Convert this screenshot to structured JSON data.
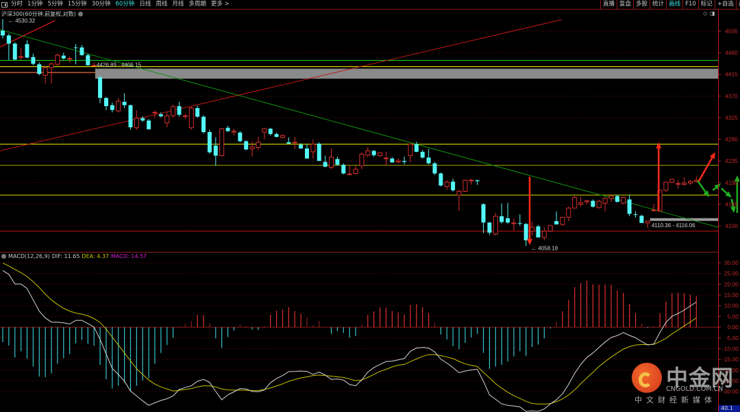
{
  "toolbar": {
    "periods": [
      "分时",
      "1分钟",
      "5分钟",
      "15分钟",
      "30分钟",
      "60分钟",
      "日线",
      "周线",
      "月线",
      "多周期",
      "更多 >"
    ],
    "active_period": "60分钟",
    "right_buttons": [
      "直播",
      "复盘",
      "多股",
      "统计",
      "画线",
      "F10",
      "标记",
      "+自选",
      "返回"
    ],
    "active_right": "画线"
  },
  "title": "沪深300(60分钟,前复权,对数)",
  "window_icons": [
    "◇",
    "◨"
  ],
  "macd_header": {
    "name": "MACD(12,26,9)",
    "dif_label": "DIF: 11.65",
    "dea_label": "DEA: 4.37",
    "macd_label": "MACD: 14.57"
  },
  "colors": {
    "bull": "#d83030",
    "bear": "#54f6f6",
    "dif": "#d8d8d8",
    "dea": "#c8c400",
    "macd_label": "#d020d0",
    "axis": "#c02828",
    "grid": "#6a1010"
  },
  "logo": {
    "cn": "中金网",
    "en": "CNGOLD.COM.CN",
    "sub": "中文财经新媒体"
  },
  "corner_value": "40.1",
  "chart_data": [
    {
      "type": "candlestick",
      "title": "沪深300(60分钟,前复权,对数)",
      "ylim": [
        4046,
        4527
      ],
      "yticks": [
        4505,
        4460,
        4415,
        4370,
        4325,
        4280,
        4235,
        4190,
        4145,
        4100
      ],
      "grid": true,
      "ohlc": [
        [
          4506,
          4530,
          4490,
          4496
        ],
        [
          4496,
          4500,
          4445,
          4479
        ],
        [
          4479,
          4482,
          4444,
          4446
        ],
        [
          4450,
          4470,
          4445,
          4452
        ],
        [
          4478,
          4486,
          4448,
          4450
        ],
        [
          4451,
          4458,
          4434,
          4437
        ],
        [
          4436,
          4440,
          4413,
          4416
        ],
        [
          4413,
          4432,
          4396,
          4429
        ],
        [
          4429,
          4440,
          4396,
          4437
        ],
        [
          4436,
          4458,
          4433,
          4455
        ],
        [
          4454,
          4460,
          4446,
          4448
        ],
        [
          4448,
          4452,
          4440,
          4448
        ],
        [
          4471,
          4478,
          4436,
          4470
        ],
        [
          4471,
          4476,
          4454,
          4455
        ],
        [
          4455,
          4458,
          4433,
          4434
        ],
        [
          4434,
          4440,
          4432,
          4434
        ],
        [
          4409,
          4412,
          4355,
          4366
        ],
        [
          4366,
          4368,
          4341,
          4349
        ],
        [
          4351,
          4356,
          4336,
          4341
        ],
        [
          4339,
          4366,
          4336,
          4359
        ],
        [
          4358,
          4376,
          4345,
          4351
        ],
        [
          4351,
          4352,
          4300,
          4305
        ],
        [
          4304,
          4340,
          4300,
          4324
        ],
        [
          4324,
          4328,
          4316,
          4319
        ],
        [
          4319,
          4322,
          4300,
          4301
        ],
        [
          4336,
          4340,
          4325,
          4336
        ],
        [
          4332,
          4336,
          4325,
          4328
        ],
        [
          4314,
          4336,
          4305,
          4329
        ],
        [
          4329,
          4352,
          4325,
          4348
        ],
        [
          4349,
          4358,
          4327,
          4331
        ],
        [
          4329,
          4333,
          4322,
          4329
        ],
        [
          4304,
          4348,
          4300,
          4345
        ],
        [
          4345,
          4350,
          4325,
          4327
        ],
        [
          4327,
          4330,
          4292,
          4295
        ],
        [
          4295,
          4300,
          4250,
          4253
        ],
        [
          4267,
          4284,
          4225,
          4246
        ],
        [
          4246,
          4304,
          4244,
          4302
        ],
        [
          4304,
          4308,
          4295,
          4297
        ],
        [
          4295,
          4302,
          4288,
          4297
        ],
        [
          4294,
          4297,
          4274,
          4276
        ],
        [
          4276,
          4278,
          4257,
          4259
        ],
        [
          4260,
          4276,
          4244,
          4264
        ],
        [
          4263,
          4285,
          4258,
          4274
        ],
        [
          4295,
          4304,
          4280,
          4302
        ],
        [
          4302,
          4304,
          4288,
          4291
        ],
        [
          4291,
          4294,
          4284,
          4285
        ],
        [
          4284,
          4290,
          4282,
          4288
        ],
        [
          4274,
          4284,
          4270,
          4271
        ],
        [
          4274,
          4285,
          4260,
          4274
        ],
        [
          4269,
          4272,
          4260,
          4261
        ],
        [
          4261,
          4270,
          4240,
          4240
        ],
        [
          4254,
          4279,
          4240,
          4270
        ],
        [
          4271,
          4274,
          4235,
          4235
        ],
        [
          4233,
          4246,
          4222,
          4223
        ],
        [
          4222,
          4261,
          4218,
          4243
        ],
        [
          4239,
          4244,
          4225,
          4227
        ],
        [
          4227,
          4230,
          4207,
          4209
        ],
        [
          4208,
          4225,
          4205,
          4208
        ],
        [
          4209,
          4225,
          4207,
          4218
        ],
        [
          4225,
          4253,
          4218,
          4249
        ],
        [
          4247,
          4264,
          4243,
          4256
        ],
        [
          4256,
          4258,
          4244,
          4247
        ],
        [
          4246,
          4253,
          4243,
          4252
        ],
        [
          4240,
          4254,
          4225,
          4241
        ],
        [
          4240,
          4243,
          4231,
          4232
        ],
        [
          4233,
          4241,
          4230,
          4235
        ],
        [
          4235,
          4244,
          4228,
          4233
        ],
        [
          4246,
          4272,
          4232,
          4270
        ],
        [
          4270,
          4275,
          4253,
          4254
        ],
        [
          4254,
          4258,
          4240,
          4242
        ],
        [
          4242,
          4260,
          4228,
          4230
        ],
        [
          4230,
          4233,
          4206,
          4209
        ],
        [
          4209,
          4211,
          4182,
          4184
        ],
        [
          4182,
          4195,
          4176,
          4191
        ],
        [
          4192,
          4198,
          4171,
          4174
        ],
        [
          4164,
          4175,
          4131,
          4172
        ],
        [
          4172,
          4196,
          4170,
          4195
        ],
        [
          4195,
          4198,
          4186,
          4195
        ],
        [
          4195,
          4196,
          4185,
          4193
        ],
        [
          4145,
          4147,
          4085,
          4107
        ],
        [
          4107,
          4108,
          4081,
          4086
        ],
        [
          4083,
          4127,
          4080,
          4120
        ],
        [
          4120,
          4147,
          4105,
          4108
        ],
        [
          4116,
          4148,
          4104,
          4107
        ],
        [
          4106,
          4115,
          4090,
          4106
        ],
        [
          4106,
          4124,
          4100,
          4105
        ],
        [
          4104,
          4106,
          4058,
          4070
        ],
        [
          4089,
          4109,
          4080,
          4097
        ],
        [
          4099,
          4102,
          4076,
          4076
        ],
        [
          4076,
          4097,
          4070,
          4089
        ],
        [
          4089,
          4101,
          4087,
          4101
        ],
        [
          4110,
          4130,
          4103,
          4103
        ],
        [
          4103,
          4118,
          4100,
          4118
        ],
        [
          4118,
          4140,
          4110,
          4137
        ],
        [
          4137,
          4162,
          4136,
          4159
        ],
        [
          4145,
          4160,
          4140,
          4148
        ],
        [
          4150,
          4154,
          4145,
          4152
        ],
        [
          4152,
          4155,
          4138,
          4140
        ],
        [
          4138,
          4154,
          4136,
          4151
        ],
        [
          4147,
          4160,
          4130,
          4157
        ],
        [
          4157,
          4164,
          4150,
          4162
        ],
        [
          4162,
          4165,
          4148,
          4150
        ],
        [
          4147,
          4160,
          4145,
          4159
        ],
        [
          4155,
          4165,
          4120,
          4125
        ],
        [
          4124,
          4130,
          4117,
          4123
        ],
        [
          4121,
          4123,
          4106,
          4106
        ],
        [
          4106,
          4110,
          4096,
          4110
        ],
        [
          4133,
          4145,
          4130,
          4133
        ],
        [
          4131,
          4174,
          4131,
          4174
        ],
        [
          4174,
          4192,
          4170,
          4191
        ],
        [
          4191,
          4198,
          4189,
          4197
        ],
        [
          4188,
          4195,
          4178,
          4188
        ],
        [
          4186,
          4201,
          4184,
          4189
        ],
        [
          4189,
          4196,
          4185,
          4192
        ],
        [
          4192,
          4203,
          4190,
          4195
        ]
      ],
      "annotations": {
        "high_label": "4530.32",
        "low_label": "4058.18",
        "zone_upper_label": "4426.89 - 4406.15",
        "zone_upper": [
          4406.15,
          4426.89
        ],
        "zone_lower_label": "4110.36 - 4116.06",
        "zone_lower": [
          4110.36,
          4116.06
        ],
        "hlines": [
          {
            "price": 4444,
            "color": "#20d020"
          },
          {
            "price": 4431,
            "color": "#e8e800"
          },
          {
            "price": 4419,
            "color": "#e07040"
          },
          {
            "price": 4270,
            "color": "#c8c400"
          },
          {
            "price": 4226,
            "color": "#8a8a00"
          },
          {
            "price": 4164,
            "color": "#c8c400"
          },
          {
            "price": 4089,
            "color": "#a01010"
          }
        ],
        "trendlines": [
          {
            "from": [
              -0.45,
              4256
            ],
            "to": [
              91.9,
              4529
            ],
            "color": "#c01818"
          },
          {
            "from": [
              -0.45,
              4508
            ],
            "to": [
              117.6,
              4097
            ],
            "color": "#109010"
          },
          {
            "from": [
              -0.45,
              4472
            ],
            "to": [
              8.6,
              4527
            ],
            "color": "#ff2020"
          }
        ],
        "arrows": [
          {
            "from": [
              86.6,
              4202
            ],
            "to": [
              86.6,
              4060
            ],
            "color": "#ff2a1a"
          },
          {
            "from": [
              107.8,
              4131
            ],
            "to": [
              107.8,
              4274
            ],
            "color": "#ff2a1a"
          },
          {
            "from": [
              114.4,
              4193
            ],
            "to": [
              117.1,
              4253
            ],
            "color": "#ff2a1a"
          },
          {
            "from": [
              114.2,
              4194
            ],
            "to": [
              116.1,
              4160
            ],
            "color": "#20b020"
          },
          {
            "from": [
              116.7,
              4174
            ],
            "to": [
              118.0,
              4188
            ],
            "color": "#20b020"
          },
          {
            "from": [
              118.1,
              4178
            ],
            "to": [
              119.8,
              4159
            ],
            "color": "#20b020"
          },
          {
            "from": [
              119.8,
              4156
            ],
            "to": [
              120.2,
              4127
            ],
            "color": "#20b020"
          },
          {
            "from": [
              120.7,
              4127
            ],
            "to": [
              120.7,
              4205
            ],
            "color": "#20b020"
          }
        ]
      }
    },
    {
      "type": "bar+line",
      "title": "MACD(12,26,9)",
      "ylim": [
        -39.5,
        33.5
      ],
      "yticks": [
        "30.00",
        "25.00",
        "20.00",
        "15.00",
        "10.00",
        "5.00",
        "0.00",
        "-5.00",
        "-10.00",
        "-15.00",
        "-20.00",
        "-25.00",
        "-30.00"
      ],
      "macd": [
        -6.9,
        -8.6,
        -14.1,
        -11.2,
        -14.6,
        -18.3,
        -23,
        -23.3,
        -21.5,
        -17,
        -14.4,
        -12.5,
        -7.5,
        -5.9,
        -7.8,
        -8.6,
        -17.6,
        -24.3,
        -28.6,
        -27.3,
        -25.7,
        -29.9,
        -27.3,
        -24.8,
        -23.8,
        -17,
        -12,
        -8.3,
        -4.9,
        0.4,
        1.7,
        2.9,
        5.9,
        5.7,
        1.9,
        -5.2,
        -9.7,
        -4.6,
        -1.5,
        1.2,
        0.6,
        -1.1,
        -1.3,
        0.6,
        5.9,
        7.7,
        8.2,
        9.3,
        7.5,
        6.2,
        4.5,
        0.9,
        2.9,
        0,
        -3.1,
        -1.8,
        -2.7,
        -4.9,
        -4.1,
        1.1,
        5.7,
        7.4,
        9.3,
        9.1,
        7.6,
        6.9,
        5.9,
        10.3,
        10.8,
        9.3,
        6.6,
        2.1,
        -3.4,
        -5.7,
        -8.8,
        -10.2,
        -7.3,
        -4.8,
        -3.1,
        -12,
        -19.4,
        -18.3,
        -17.5,
        -16,
        -13.6,
        -11.2,
        -13.3,
        -9.2,
        -8.1,
        -5.2,
        -0.6,
        2.5,
        7.4,
        12.8,
        18.7,
        20.6,
        21.7,
        19.9,
        19.8,
        19.8,
        19.8,
        17.2,
        16.1,
        10.8,
        6.6,
        1.7,
        -0.4,
        0.6,
        6.6,
        12,
        15.9,
        16.1,
        15.9,
        15.2,
        14.57
      ],
      "dif": [
        26.4,
        24.6,
        20.1,
        20.1,
        18,
        12.7,
        7.5,
        4.3,
        2.4,
        2.3,
        2,
        1.5,
        3.2,
        3.2,
        1.7,
        0.1,
        -5.7,
        -12.5,
        -19.2,
        -22,
        -25.2,
        -29.7,
        -32,
        -34.3,
        -36.4,
        -35.2,
        -34.1,
        -33.3,
        -32,
        -29,
        -28.1,
        -27.3,
        -25.2,
        -24.3,
        -25.7,
        -29.9,
        -33.8,
        -31.5,
        -30.1,
        -28.6,
        -28.8,
        -29.9,
        -30.1,
        -29.2,
        -25.9,
        -23.9,
        -22.5,
        -20.7,
        -20.6,
        -20.4,
        -20.6,
        -22,
        -20.9,
        -22.3,
        -24.3,
        -24.1,
        -24.6,
        -26.7,
        -27.3,
        -24.6,
        -20.9,
        -18.8,
        -17.3,
        -16,
        -15.8,
        -15.2,
        -14.6,
        -11.2,
        -9.7,
        -9.4,
        -9.7,
        -11.5,
        -14.9,
        -16.7,
        -18.8,
        -21.2,
        -20.4,
        -19.9,
        -19.6,
        -25.2,
        -31.5,
        -33.6,
        -35.7,
        -36.4,
        -36.7,
        -37.1,
        -39.2,
        -39,
        -39.2,
        -38.1,
        -35.7,
        -33.8,
        -31,
        -26.7,
        -21.5,
        -17.3,
        -14.1,
        -12,
        -9.4,
        -6.9,
        -4.8,
        -3.9,
        -2.5,
        -3.8,
        -4.9,
        -6.7,
        -8.3,
        -7.8,
        -2.5,
        2.2,
        5.1,
        6.4,
        8,
        9.9,
        11.65
      ],
      "dea": [
        29.9,
        28.5,
        26.9,
        25.4,
        23.6,
        21.2,
        18.5,
        15.4,
        12.7,
        10.6,
        8.8,
        7.5,
        6.6,
        6.1,
        5.3,
        4,
        2.2,
        -0.9,
        -4.6,
        -8.3,
        -12,
        -15.7,
        -19.4,
        -22,
        -24.6,
        -26.5,
        -27.8,
        -28.8,
        -29.7,
        -29.4,
        -29,
        -28.6,
        -27.8,
        -27.3,
        -27.3,
        -27.8,
        -28.8,
        -29.2,
        -29.3,
        -29.3,
        -29.4,
        -29.5,
        -29.5,
        -29,
        -28.3,
        -27.4,
        -26.4,
        -25.2,
        -24.4,
        -23.6,
        -23.1,
        -22.5,
        -22.3,
        -22.5,
        -22.8,
        -23.1,
        -23.4,
        -24.1,
        -24.9,
        -24.6,
        -23.4,
        -22,
        -20.6,
        -19.6,
        -18.5,
        -17.7,
        -17.3,
        -16,
        -14.8,
        -13.6,
        -12.8,
        -12.8,
        -13.2,
        -13.9,
        -14.6,
        -15.9,
        -17.1,
        -17.8,
        -18.3,
        -21,
        -23.6,
        -26.3,
        -28.4,
        -30.3,
        -31.9,
        -33.2,
        -34.5,
        -35.5,
        -35.8,
        -35.8,
        -35.6,
        -34.7,
        -33.4,
        -31.6,
        -29.2,
        -26.3,
        -23.6,
        -21,
        -18.3,
        -16,
        -13.9,
        -12,
        -10.2,
        -9.1,
        -8.3,
        -8.1,
        -8.1,
        -8,
        -6.7,
        -5.2,
        -3.1,
        -1.3,
        0.6,
        2.4,
        4.37
      ]
    }
  ]
}
